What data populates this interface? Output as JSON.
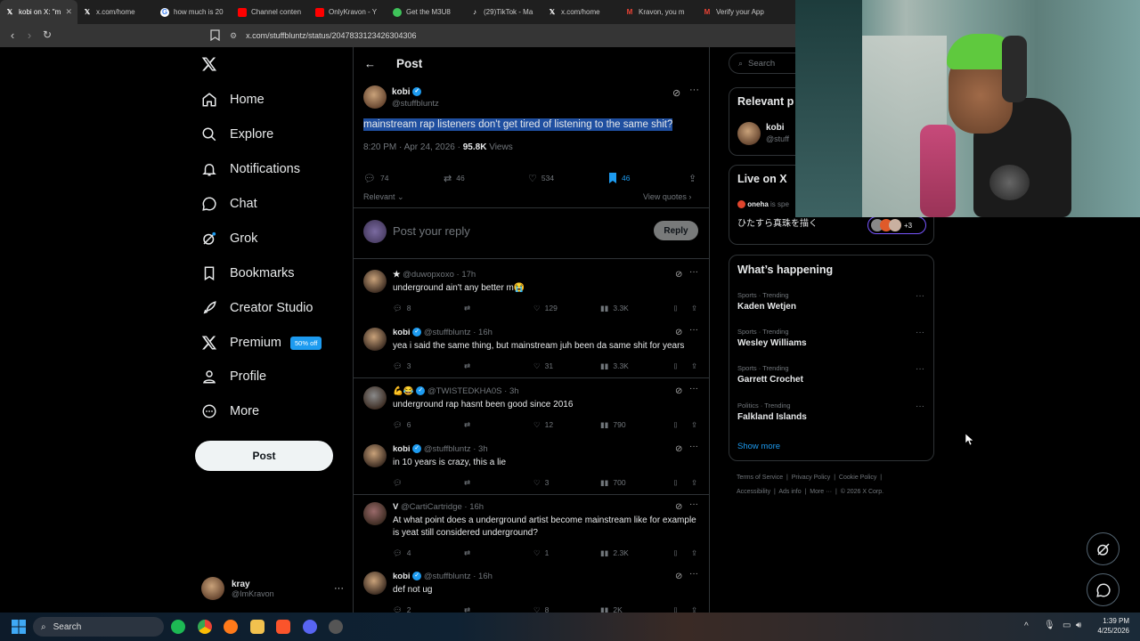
{
  "browser": {
    "tabs": [
      {
        "label": "kobi on X: \"m",
        "active": true,
        "icon": "x-icon"
      },
      {
        "label": "x.com/home",
        "icon": "x-icon"
      },
      {
        "label": "how much is 20",
        "icon": "google-icon"
      },
      {
        "label": "Channel conten",
        "icon": "youtube-icon"
      },
      {
        "label": "OnlyKravon - Y",
        "icon": "youtube-icon"
      },
      {
        "label": "Get the M3U8",
        "icon": "chrome-ext-icon"
      },
      {
        "label": "(29)TikTok - Ma",
        "icon": "tiktok-icon"
      },
      {
        "label": "x.com/home",
        "icon": "x-icon"
      },
      {
        "label": "Kravon, you m",
        "icon": "gmail-icon"
      },
      {
        "label": "Verify your App",
        "icon": "gmail-icon"
      }
    ],
    "url": "x.com/stuffbluntz/status/2047833123426304306"
  },
  "nav": {
    "items": [
      {
        "label": "Home",
        "icon": "home-icon"
      },
      {
        "label": "Explore",
        "icon": "search-icon"
      },
      {
        "label": "Notifications",
        "icon": "bell-icon"
      },
      {
        "label": "Chat",
        "icon": "chat-icon"
      },
      {
        "label": "Grok",
        "icon": "grok-icon"
      },
      {
        "label": "Bookmarks",
        "icon": "bookmark-icon"
      },
      {
        "label": "Creator Studio",
        "icon": "rocket-icon"
      },
      {
        "label": "Premium",
        "icon": "x-logo-icon"
      },
      {
        "label": "Profile",
        "icon": "person-icon"
      },
      {
        "label": "More",
        "icon": "more-circle-icon"
      }
    ],
    "premium_badge": "50% off",
    "post_button": "Post",
    "account": {
      "name": "kray",
      "handle": "@ImKravon"
    }
  },
  "post": {
    "header": "Post",
    "author": {
      "name": "kobi",
      "handle": "@stuffbluntz"
    },
    "text": "mainstream rap listeners don't get tired of listening to the same shit?",
    "time": "8:20 PM · Apr 24, 2026 · ",
    "views": "95.8K",
    "views_label": "Views",
    "stats": {
      "replies": "74",
      "reposts": "46",
      "likes": "534",
      "bookmarks": "46"
    },
    "sort": "Relevant",
    "view_quotes": "View quotes",
    "reply_placeholder": "Post your reply",
    "reply_button": "Reply"
  },
  "replies": [
    {
      "name": "★",
      "handle": "@duwopxoxo",
      "time": "· 17h",
      "verified": false,
      "text": "underground ain't any better m😭",
      "replies": "8",
      "reposts": "",
      "likes": "129",
      "views": "3.3K"
    },
    {
      "name": "kobi",
      "handle": "@stuffbluntz",
      "time": "· 16h",
      "verified": true,
      "text": "yea i said the same thing, but mainstream juh been da same shit for years",
      "replies": "3",
      "reposts": "",
      "likes": "31",
      "views": "3.3K"
    },
    {
      "name": "💪😂",
      "handle": "@TWISTEDKHA0S",
      "time": "· 3h",
      "verified": true,
      "text": "underground rap hasnt been good since 2016",
      "replies": "6",
      "reposts": "",
      "likes": "12",
      "views": "790"
    },
    {
      "name": "kobi",
      "handle": "@stuffbluntz",
      "time": "· 3h",
      "verified": true,
      "text": "in 10 years is crazy, this a lie",
      "replies": "",
      "reposts": "",
      "likes": "3",
      "views": "700"
    },
    {
      "name": "V",
      "handle": "@CartiCartridge",
      "time": "· 16h",
      "verified": false,
      "text": "At what point does a underground artist become mainstream like for example is yeat still considered underground?",
      "replies": "4",
      "reposts": "",
      "likes": "1",
      "views": "2.3K"
    },
    {
      "name": "kobi",
      "handle": "@stuffbluntz",
      "time": "· 16h",
      "verified": true,
      "text": "def not ug",
      "replies": "2",
      "reposts": "",
      "likes": "8",
      "views": "2K"
    }
  ],
  "right": {
    "search_placeholder": "Search",
    "relevant_title": "Relevant p",
    "relevant_name": "kobi",
    "relevant_handle": "@stuff",
    "live_title": "Live on X",
    "live_user": "oneha",
    "live_user_suffix": " is spe",
    "live_text": "ひたすら真珠を描く",
    "live_count": "+3",
    "happening_title": "What’s happening",
    "trends": [
      {
        "category": "Sports · Trending",
        "name": "Kaden Wetjen"
      },
      {
        "category": "Sports · Trending",
        "name": "Wesley Williams"
      },
      {
        "category": "Sports · Trending",
        "name": "Garrett Crochet"
      },
      {
        "category": "Politics · Trending",
        "name": "Falkland Islands"
      }
    ],
    "show_more": "Show more",
    "footer": [
      "Terms of Service",
      "Privacy Policy",
      "Cookie Policy",
      "Accessibility",
      "Ads info",
      "More ···",
      "© 2026 X Corp."
    ]
  },
  "taskbar": {
    "search": "Search",
    "time": "1:39 PM",
    "date": "4/25/2026"
  },
  "colors": {
    "accent": "#1d9bf0",
    "background": "#000000",
    "border": "#2f3336",
    "muted": "#71767b",
    "highlight": "#1f4fa0"
  }
}
